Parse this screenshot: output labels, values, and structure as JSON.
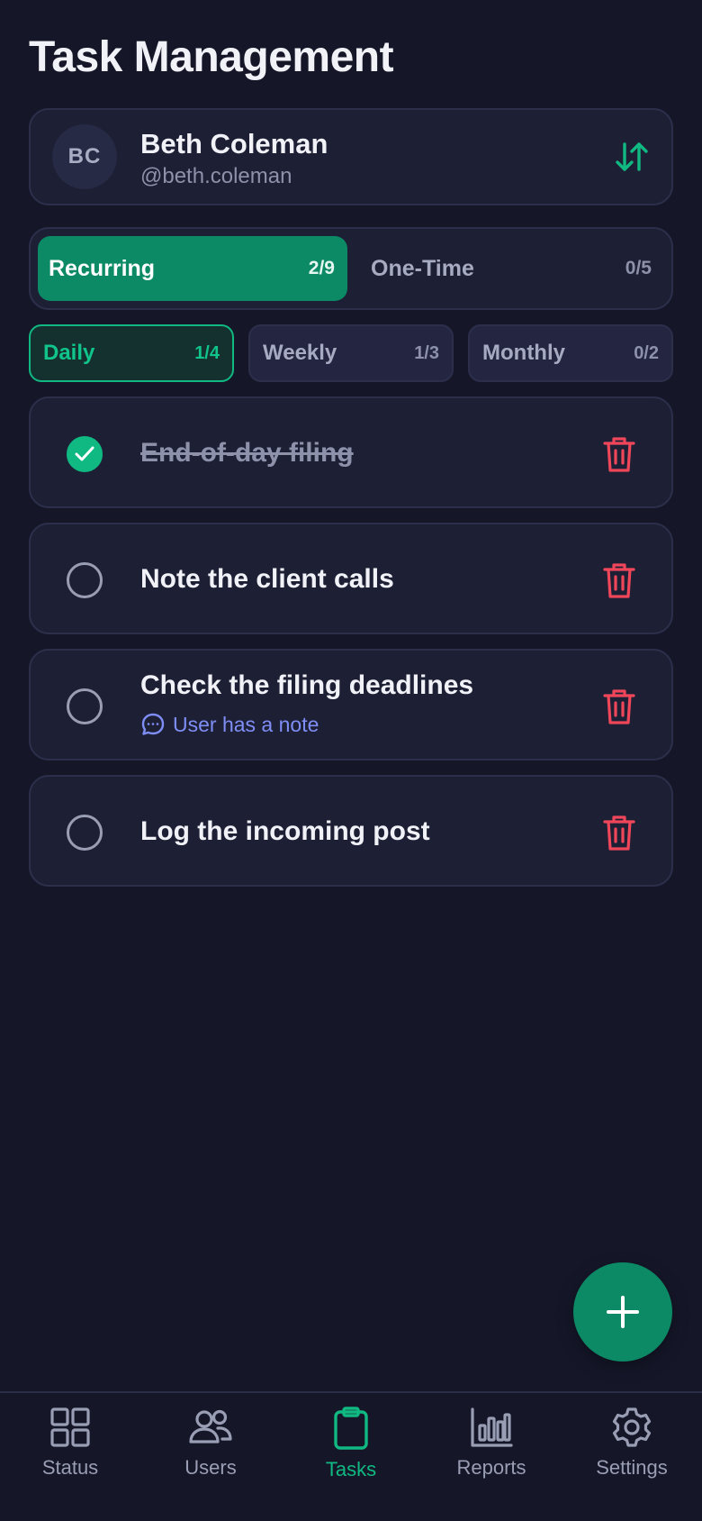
{
  "page": {
    "title": "Task Management"
  },
  "user": {
    "initials": "BC",
    "name": "Beth Coleman",
    "handle": "@beth.coleman",
    "swap_icon": "swap-vertical-icon"
  },
  "task_types": [
    {
      "label": "Recurring",
      "count": "2/9",
      "active": true
    },
    {
      "label": "One-Time",
      "count": "0/5",
      "active": false
    }
  ],
  "frequency_tabs": [
    {
      "label": "Daily",
      "count": "1/4",
      "active": true
    },
    {
      "label": "Weekly",
      "count": "1/3",
      "active": false
    },
    {
      "label": "Monthly",
      "count": "0/2",
      "active": false
    }
  ],
  "tasks": [
    {
      "title": "End-of-day filing",
      "done": true
    },
    {
      "title": "Note the client calls",
      "done": false
    },
    {
      "title": "Check the filing deadlines",
      "done": false,
      "note": "User has a note"
    },
    {
      "title": "Log the incoming post",
      "done": false
    }
  ],
  "nav": [
    {
      "label": "Status",
      "icon": "grid-icon"
    },
    {
      "label": "Users",
      "icon": "users-icon"
    },
    {
      "label": "Tasks",
      "icon": "clipboard-icon",
      "active": true
    },
    {
      "label": "Reports",
      "icon": "bar-chart-icon"
    },
    {
      "label": "Settings",
      "icon": "gear-icon"
    }
  ],
  "colors": {
    "accent": "#10b981",
    "accent_dark": "#0c8a65",
    "danger": "#f0465a",
    "note": "#7f8ef5",
    "background": "#151729",
    "card": "#1d1f35"
  }
}
